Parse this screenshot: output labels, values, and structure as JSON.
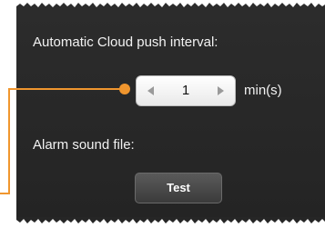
{
  "settings": {
    "push_interval_label": "Automatic Cloud push interval:",
    "push_interval_value": "1",
    "push_interval_unit": "min(s)",
    "stepper_decrement_icon": "left-triangle-icon",
    "stepper_increment_icon": "right-triangle-icon",
    "alarm_sound_label": "Alarm sound file:",
    "test_button_label": "Test"
  },
  "colors": {
    "panel_background": "#2a2a2a",
    "callout": "#f0962e",
    "text": "#f2f2f2"
  }
}
